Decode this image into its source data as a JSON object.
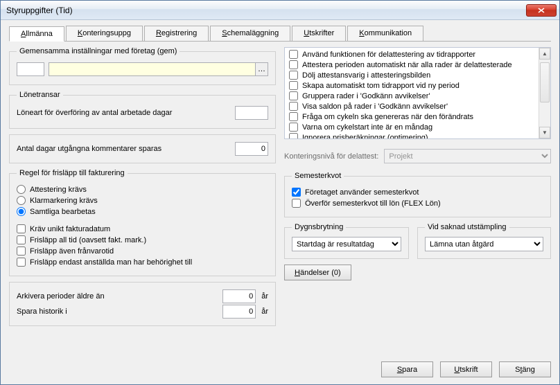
{
  "window": {
    "title": "Styruppgifter (Tid)"
  },
  "tabs": {
    "items": [
      "Allmänna",
      "Konteringsuppg",
      "Registrering",
      "Schemaläggning",
      "Utskrifter",
      "Kommunikation"
    ],
    "activeIndex": 0,
    "underlineIndex": [
      0,
      0,
      0,
      0,
      0,
      0
    ]
  },
  "left": {
    "gem_legend": "Gemensamma inställningar med företag (gem)",
    "lonetransar_legend": "Lönetransar",
    "lonetransar_label": "Löneart för överföring av antal arbetade dagar",
    "antal_dagar_label": "Antal dagar utgångna kommentarer sparas",
    "antal_dagar_value": "0",
    "regel_legend": "Regel för frisläpp till fakturering",
    "radios": [
      "Attestering krävs",
      "Klarmarkering krävs",
      "Samtliga bearbetas"
    ],
    "radio_checked": 2,
    "checks": [
      "Kräv unikt fakturadatum",
      "Frisläpp all tid (oavsett fakt. mark.)",
      "Frisläpp även frånvarotid",
      "Frisläpp endast anställda man har behörighet till"
    ],
    "arkivera_label": "Arkivera perioder äldre än",
    "arkivera_value": "0",
    "ar_unit": "år",
    "spara_label": "Spara historik i",
    "spara_value": "0"
  },
  "right": {
    "list_items": [
      "Använd funktionen för delattestering av tidrapporter",
      "Attestera perioden automatiskt när alla rader är delattesterade",
      "Dölj attestansvarig i attesteringsbilden",
      "Skapa automatiskt tom tidrapport vid ny period",
      "Gruppera rader i 'Godkänn avvikelser'",
      "Visa saldon på rader i 'Godkänn avvikelser'",
      "Fråga om cykeln ska genereras när den förändrats",
      "Varna om cykelstart inte är en måndag",
      "Ignorera prisberäkningar (optimering)"
    ],
    "konteringsniva_label": "Konteringsnivå för delattest:",
    "konteringsniva_value": "Projekt",
    "semesterkvot_legend": "Semesterkvot",
    "sem_checks": [
      {
        "label": "Företaget använder semesterkvot",
        "checked": true
      },
      {
        "label": "Överför semesterkvot till lön (FLEX Lön)",
        "checked": false
      }
    ],
    "dygns_legend": "Dygnsbrytning",
    "dygns_value": "Startdag är resultatdag",
    "vidsaknad_legend": "Vid saknad utstämpling",
    "vidsaknad_value": "Lämna utan åtgärd",
    "handelser_button": "Händelser (0)"
  },
  "footer": {
    "spara": "Spara",
    "utskrift": "Utskrift",
    "stang": "Stäng"
  }
}
